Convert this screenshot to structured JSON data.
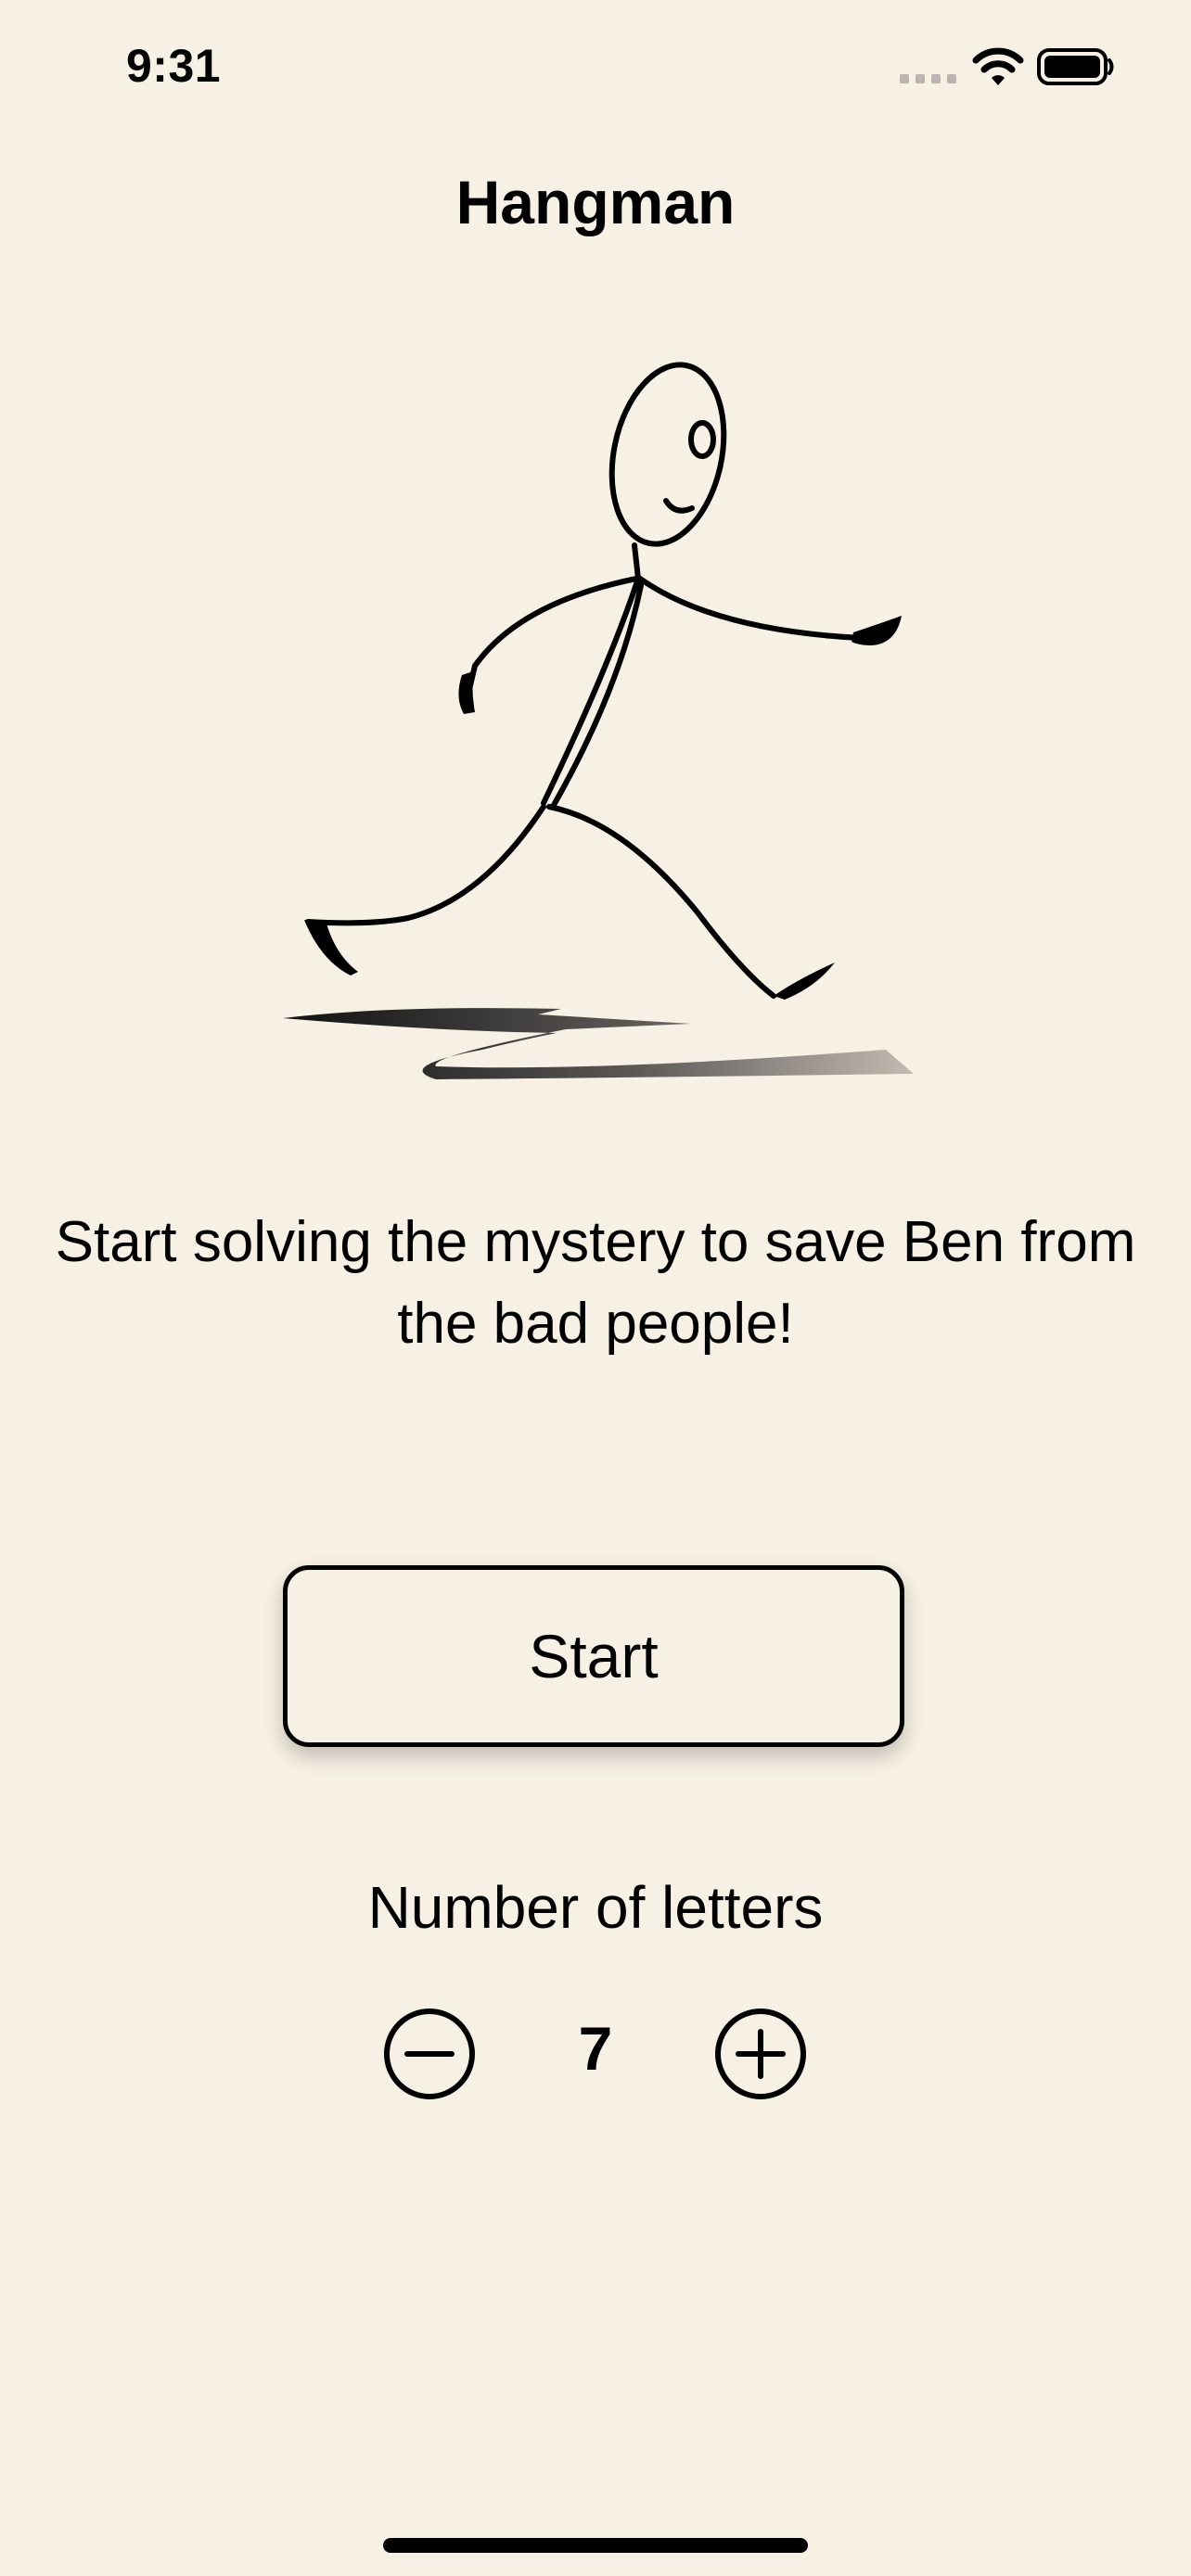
{
  "status_bar": {
    "time": "9:31",
    "icons": [
      "signal-icon",
      "wifi-icon",
      "battery-icon"
    ]
  },
  "header": {
    "title": "Hangman"
  },
  "hero": {
    "icon": "running-stick-figure"
  },
  "main": {
    "tagline": "Start solving the mystery to save Ben from the bad people!",
    "start_label": "Start",
    "letters_label": "Number of letters",
    "letter_count": "7",
    "decrement_icon": "minus-circle-icon",
    "increment_icon": "plus-circle-icon"
  },
  "colors": {
    "background": "#f7f0e4",
    "foreground": "#000000"
  }
}
